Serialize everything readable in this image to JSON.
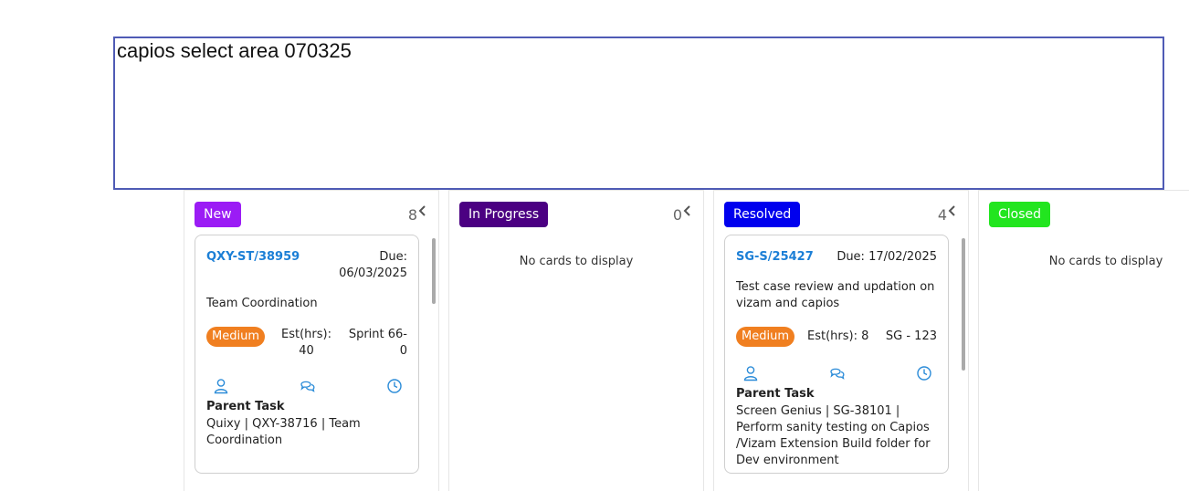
{
  "select_area": {
    "label": "capios select area 070325",
    "border_color": "#4f5bb5"
  },
  "columns": [
    {
      "status": "New",
      "color": "#9b1cf5",
      "count": "8"
    },
    {
      "status": "In Progress",
      "color": "#4b0082",
      "count": "0",
      "empty_text": "No cards to display"
    },
    {
      "status": "Resolved",
      "color": "#0000ee",
      "count": "4"
    },
    {
      "status": "Closed",
      "color": "#22e51f",
      "empty_text": "No cards to display"
    }
  ],
  "cards": [
    {
      "id": "QXY-ST/38959",
      "due_label": "Due:",
      "due_date": "06/03/2025",
      "title": "Team Coordination",
      "priority": "Medium",
      "est_label": "Est(hrs):",
      "est_value": "40",
      "sprint_line1": "Sprint 66-",
      "sprint_line2": "0",
      "parent_label": "Parent Task",
      "parent_line1": "Quixy | QXY-38716 | Team",
      "parent_line2": "Coordination"
    },
    {
      "id": "SG-S/25427",
      "due": "Due: 17/02/2025",
      "title_line1": "Test case review and updation on",
      "title_line2": "vizam and capios",
      "priority": "Medium",
      "est": "Est(hrs): 8",
      "sprint": "SG - 123",
      "parent_label": "Parent Task",
      "parent_line1": "Screen Genius | SG-38101 |",
      "parent_line2": "Perform sanity testing on Capios",
      "parent_line3": "/Vizam Extension Build folder for",
      "parent_line4": "Dev environment"
    }
  ],
  "icons": {
    "assignee": "user-icon",
    "comments": "comments-icon",
    "time": "clock-icon",
    "collapse": "chevron-left-icon"
  },
  "colors": {
    "link": "#1c7fd6",
    "priority_medium": "#f07f20",
    "icon": "#2a8bd8"
  }
}
